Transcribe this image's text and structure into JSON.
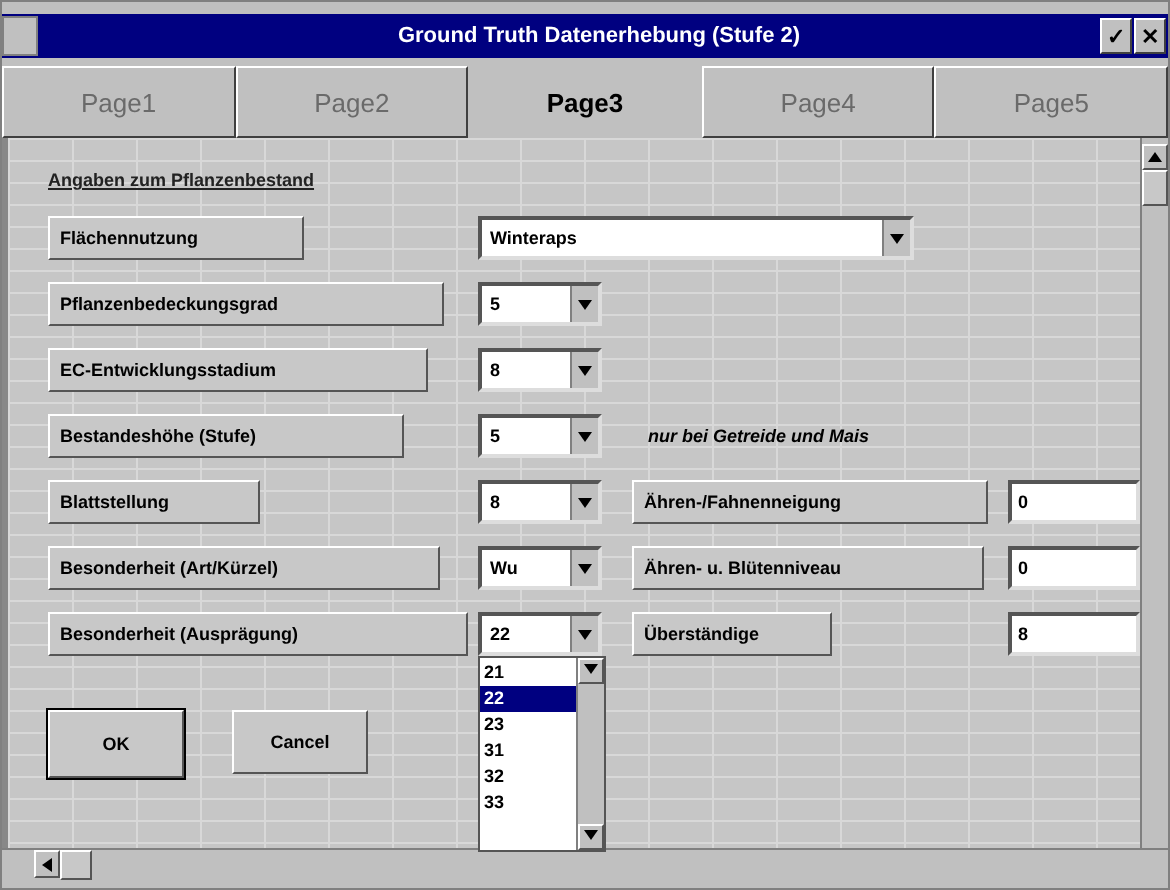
{
  "window": {
    "title": "Ground Truth Datenerhebung (Stufe 2)",
    "controls": [
      "✓",
      "✕"
    ]
  },
  "tabs": [
    {
      "label": "Page1",
      "selected": false
    },
    {
      "label": "Page2",
      "selected": false
    },
    {
      "label": "Page3",
      "selected": true
    },
    {
      "label": "Page4",
      "selected": false
    },
    {
      "label": "Page5",
      "selected": false
    }
  ],
  "section_title": "Angaben zum Pflanzenbestand",
  "fields": [
    {
      "label": "Flächennutzung",
      "value": "Winteraps",
      "wide": true
    },
    {
      "label": "Pflanzenbedeckungsgrad",
      "value": "5"
    },
    {
      "label": "EC-Entwicklungsstadium",
      "value": "8"
    },
    {
      "label": "Bestandeshöhe (Stufe)",
      "value": "5"
    },
    {
      "label": "Blattstellung",
      "value": "8"
    },
    {
      "label": "Besonderheit (Art/Kürzel)",
      "value": "Wu"
    },
    {
      "label": "Besonderheit (Ausprägung)",
      "value": "22",
      "open": true
    }
  ],
  "note": "nur bei Getreide und Mais",
  "side_fields": [
    {
      "label": "Ähren-/Fahnenneigung",
      "value": "0"
    },
    {
      "label": "Ähren- u. Blütenniveau",
      "value": "0"
    },
    {
      "label": "Überständige",
      "value": "8"
    }
  ],
  "dropdown": [
    {
      "label": "21",
      "selected": false
    },
    {
      "label": "22",
      "selected": true
    },
    {
      "label": "23",
      "selected": false
    },
    {
      "label": "31",
      "selected": false
    },
    {
      "label": "32",
      "selected": false
    },
    {
      "label": "33",
      "selected": false
    }
  ],
  "buttons": [
    "OK",
    "Cancel"
  ]
}
